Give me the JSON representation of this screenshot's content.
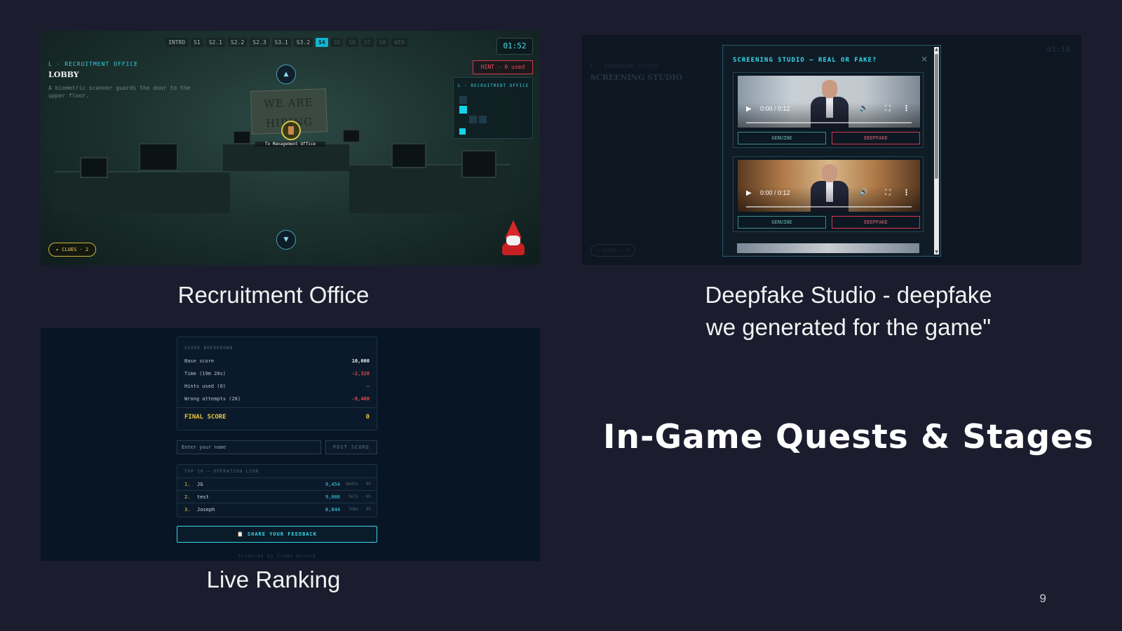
{
  "slide": {
    "title": "In-Game Quests & Stages",
    "page_number": "9"
  },
  "captions": {
    "recruitment": "Recruitment Office",
    "deepfake_line1": "Deepfake Studio - deepfake",
    "deepfake_line2": "we generated for the game\"",
    "ranking": "Live Ranking"
  },
  "recruitment_office": {
    "stages": [
      "INTRO",
      "S1",
      "S2.1",
      "S2.2",
      "S2.3",
      "S3.1",
      "S3.2",
      "S4",
      "S5",
      "S6",
      "S7",
      "S8",
      "WIN"
    ],
    "active_stage": "S4",
    "timer": "01:52",
    "location_label": "L · RECRUITMENT OFFICE",
    "room_title": "LOBBY",
    "room_description": "A biometric scanner guards the door to the upper floor.",
    "hint_button": "HINT · 0 used",
    "map_title": "L · RECRUITMENT OFFICE",
    "banner_text_line1": "WE ARE",
    "banner_text_line2": "HIRING",
    "door_label": "To Management Office",
    "clues": "▸ CLUES · 2",
    "nav_up": "▲",
    "nav_down": "▼"
  },
  "deepfake_studio": {
    "background_label": "L · SCREENING STUDIO",
    "background_title": "SCREENING STUDIO",
    "background_timer": "01:18",
    "background_clues": "▸ CLUES · 4",
    "modal_title": "SCREENING STUDIO — REAL OR FAKE?",
    "close": "×",
    "videos": [
      {
        "time": "0:00 / 0:12",
        "genuine_label": "GENUINE",
        "deepfake_label": "DEEPFAKE"
      },
      {
        "time": "0:00 / 0:12",
        "genuine_label": "GENUINE",
        "deepfake_label": "DEEPFAKE"
      }
    ]
  },
  "live_ranking": {
    "breakdown_title": "SCORE BREAKDOWN",
    "rows": [
      {
        "label": "Base score",
        "value": "10,000"
      },
      {
        "label": "Time (19m 20s)",
        "value": "-2,320"
      },
      {
        "label": "Hints used (0)",
        "value": "—"
      },
      {
        "label": "Wrong attempts (28)",
        "value": "-8,400"
      }
    ],
    "final_label": "FINAL SCORE",
    "final_value": "0",
    "name_placeholder": "Enter your name",
    "post_button": "POST SCORE",
    "leaderboard_title": "TOP 10 — OPERATION LION",
    "leaderboard": [
      {
        "rank": "1.",
        "name": "JG",
        "score": "9,454",
        "meta": "4m43s · 0h"
      },
      {
        "rank": "2.",
        "name": "test",
        "score": "9,006",
        "meta": "5m7s · 0h"
      },
      {
        "rank": "3.",
        "name": "Joseph",
        "score": "8,844",
        "meta": "7m8s · 0h"
      }
    ],
    "feedback_button": "📋 SHARE YOUR FEEDBACK",
    "produced_by": "Produced by Trade Wizard"
  },
  "colors": {
    "slide_bg": "#1b1d2e",
    "accent_cyan": "#38d7ea",
    "accent_red": "#e04a56",
    "accent_gold": "#e8c43a"
  }
}
